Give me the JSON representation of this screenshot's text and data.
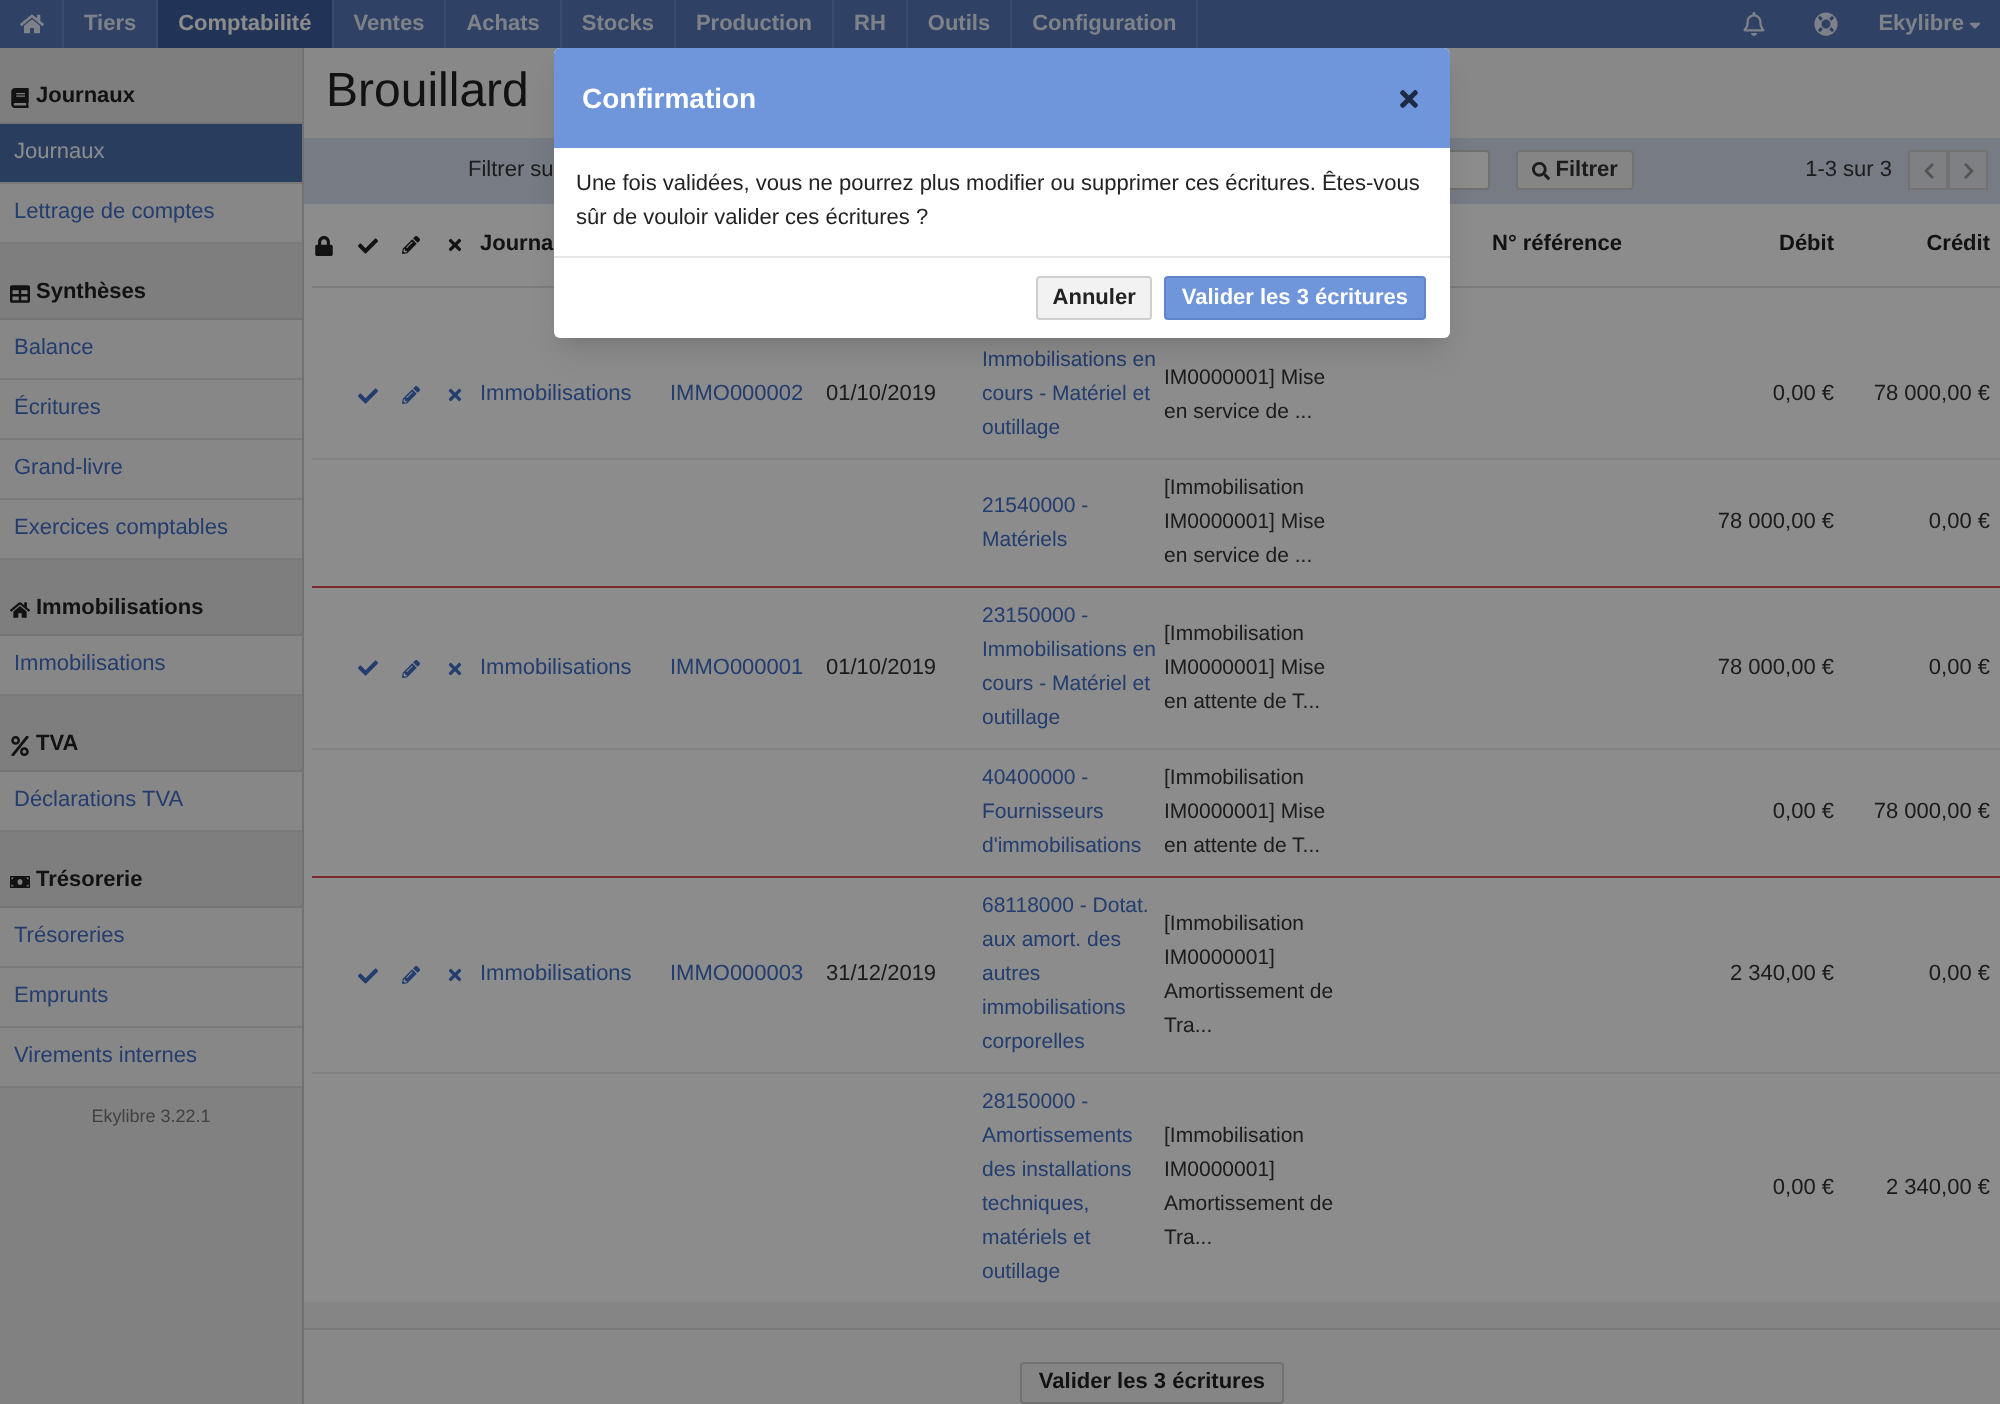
{
  "nav": {
    "items": [
      {
        "label": "Tiers",
        "selected": false
      },
      {
        "label": "Comptabilité",
        "selected": true
      },
      {
        "label": "Ventes",
        "selected": false
      },
      {
        "label": "Achats",
        "selected": false
      },
      {
        "label": "Stocks",
        "selected": false
      },
      {
        "label": "Production",
        "selected": false
      },
      {
        "label": "RH",
        "selected": false
      },
      {
        "label": "Outils",
        "selected": false
      },
      {
        "label": "Configuration",
        "selected": false
      }
    ],
    "user": "Ekylibre"
  },
  "sidebar": {
    "sections": [
      {
        "title": "Journaux",
        "items": [
          {
            "label": "Journaux",
            "selected": true
          },
          {
            "label": "Lettrage de comptes",
            "selected": false
          }
        ]
      },
      {
        "title": "Synthèses",
        "items": [
          {
            "label": "Balance",
            "selected": false
          },
          {
            "label": "Écritures",
            "selected": false
          },
          {
            "label": "Grand-livre",
            "selected": false
          },
          {
            "label": "Exercices comptables",
            "selected": false
          }
        ]
      },
      {
        "title": "Immobilisations",
        "items": [
          {
            "label": "Immobilisations",
            "selected": false
          }
        ]
      },
      {
        "title": "TVA",
        "items": [
          {
            "label": "Déclarations TVA",
            "selected": false
          }
        ]
      },
      {
        "title": "Trésorerie",
        "items": [
          {
            "label": "Trésoreries",
            "selected": false
          },
          {
            "label": "Emprunts",
            "selected": false
          },
          {
            "label": "Virements internes",
            "selected": false
          }
        ]
      }
    ],
    "version": "Ekylibre 3.22.1"
  },
  "page": {
    "title": "Brouillard"
  },
  "filter": {
    "label": "Filtrer su",
    "button": "Filtrer",
    "range": "1-3 sur 3"
  },
  "table": {
    "header": {
      "journal": "Journa",
      "reference": "N° référence",
      "debit": "Débit",
      "credit": "Crédit"
    },
    "entries": [
      {
        "journal": "Immobilisations",
        "piece": "IMMO000002",
        "date": "01/10/2019",
        "lines": [
          {
            "account": "Immobilisations en cours - Matériel et outillage",
            "label": "IM0000001] Mise en service de ...",
            "debit": "0,00 €",
            "credit": "78 000,00 €"
          },
          {
            "account": "21540000 - Matériels",
            "label": "[Immobilisation IM0000001] Mise en service de ...",
            "debit": "78 000,00 €",
            "credit": "0,00 €"
          }
        ]
      },
      {
        "journal": "Immobilisations",
        "piece": "IMMO000001",
        "date": "01/10/2019",
        "lines": [
          {
            "account": "23150000 - Immobilisations en cours - Matériel et outillage",
            "label": "[Immobilisation IM0000001] Mise en attente de T...",
            "debit": "78 000,00 €",
            "credit": "0,00 €"
          },
          {
            "account": "40400000 - Fournisseurs d'immobilisations",
            "label": "[Immobilisation IM0000001] Mise en attente de T...",
            "debit": "0,00 €",
            "credit": "78 000,00 €"
          }
        ]
      },
      {
        "journal": "Immobilisations",
        "piece": "IMMO000003",
        "date": "31/12/2019",
        "lines": [
          {
            "account": "68118000 - Dotat. aux amort. des autres immobilisations corporelles",
            "label": "[Immobilisation IM0000001] Amortissement de Tra...",
            "debit": "2 340,00 €",
            "credit": "0,00 €"
          },
          {
            "account": "28150000 - Amortissements des installations techniques, matériels et outillage",
            "label": "[Immobilisation IM0000001] Amortissement de Tra...",
            "debit": "0,00 €",
            "credit": "2 340,00 €"
          }
        ]
      }
    ],
    "footer_button": "Valider les 3 écritures"
  },
  "modal": {
    "title": "Confirmation",
    "message": "Une fois validées, vous ne pourrez plus modifier ou supprimer ces écritures. Êtes-vous sûr de vouloir valider ces écritures ?",
    "cancel": "Annuler",
    "confirm": "Valider les 3 écritures"
  }
}
